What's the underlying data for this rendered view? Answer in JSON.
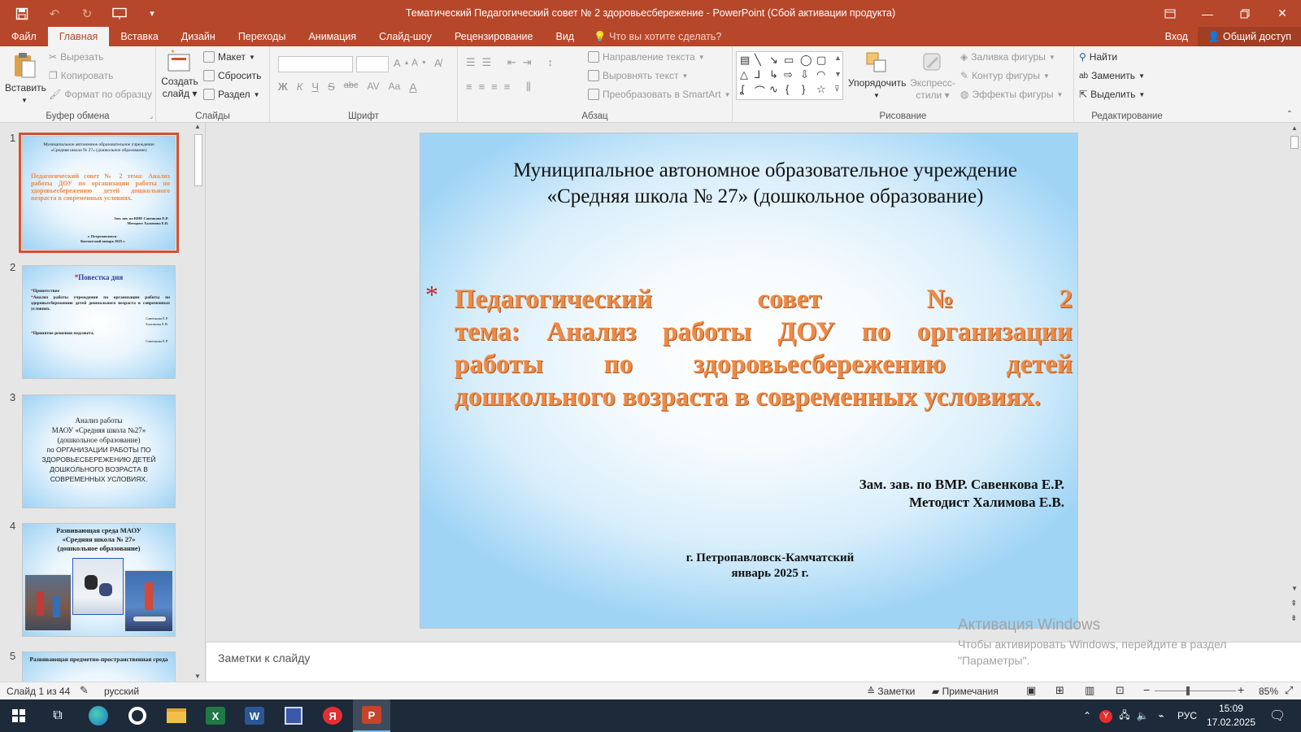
{
  "window": {
    "title": "Тематический Педагогический совет № 2 здоровьесбережение  -  PowerPoint (Сбой активации продукта)",
    "qat_icons": [
      "save-icon",
      "undo-icon",
      "redo-icon",
      "start-slideshow-icon",
      "customize-qat-icon"
    ]
  },
  "tabs": [
    "Файл",
    "Главная",
    "Вставка",
    "Дизайн",
    "Переходы",
    "Анимация",
    "Слайд-шоу",
    "Рецензирование",
    "Вид"
  ],
  "active_tab": "Главная",
  "tell_me": "Что вы хотите сделать?",
  "signin": "Вход",
  "share": "Общий доступ",
  "ribbon": {
    "clipboard": {
      "paste": "Вставить",
      "cut": "Вырезать",
      "copy": "Копировать",
      "format_painter": "Формат по образцу",
      "label": "Буфер обмена"
    },
    "slides": {
      "new_slide_line1": "Создать",
      "new_slide_line2": "слайд",
      "layout": "Макет",
      "reset": "Сбросить",
      "section": "Раздел",
      "label": "Слайды"
    },
    "font": {
      "label": "Шрифт",
      "bold": "Ж",
      "italic": "К",
      "underline": "Ч",
      "strike": "S",
      "shadow": "abc",
      "spacing": "AV",
      "case": "Aa",
      "color": "A"
    },
    "paragraph": {
      "text_direction": "Направление текста",
      "align_text": "Выровнять текст",
      "smartart": "Преобразовать в SmartArt",
      "label": "Абзац"
    },
    "drawing": {
      "arrange": "Упорядочить",
      "quick_styles_line1": "Экспресс-",
      "quick_styles_line2": "стили",
      "shape_fill": "Заливка фигуры",
      "shape_outline": "Контур фигуры",
      "shape_effects": "Эффекты фигуры",
      "label": "Рисование"
    },
    "editing": {
      "find": "Найти",
      "replace": "Заменить",
      "select": "Выделить",
      "label": "Редактирование"
    }
  },
  "thumbnails": [
    {
      "num": "1",
      "line1": "Муниципальное автономное образовательное учреждение",
      "line2": "«Средняя школа № 27» (дошкольное образование)",
      "title": "Педагогический совет № 2 тема: Анализ работы ДОУ по организации работы по здоровьесбережению детей дошкольного возраста в современных условиях.",
      "authors": "Зам. зав. по ВМР. Савенкова Е.Р. Методист Халимова Е.В.",
      "city": "г. Петропавловск-Камчатский январь 2025 г."
    },
    {
      "num": "2",
      "title": "Повестка дня",
      "item1": "Приветствие",
      "item2": "Анализ работы учреждения по организации работы по здоровьесбережению детей дошкольного возраста в современных условиях.",
      "who1": "Савенкова Е.Р.",
      "who2": "Халимова Е.В.",
      "item3": "Принятие решения педсовета.",
      "who3": "Савенкова Е.Р."
    },
    {
      "num": "3",
      "l1": "Анализ работы",
      "l2": "МАОУ «Средняя школа №27»",
      "l3": "(дошкольное образование)",
      "l4": "по ОРГАНИЗАЦИИ РАБОТЫ ПО ЗДОРОВЬЕСБЕРЕЖЕНИЮ ДЕТЕЙ ДОШКОЛЬНОГО ВОЗРАСТА В СОВРЕМЕННЫХ УСЛОВИЯХ."
    },
    {
      "num": "4",
      "l1": "Развивающая среда МАОУ",
      "l2": "«Средняя школа № 27»",
      "l3": "(дошкольное образование)"
    },
    {
      "num": "5",
      "l1": "Развивающая предметно-пространственная среда"
    }
  ],
  "slide": {
    "org_line1": "Муниципальное автономное образовательное учреждение",
    "org_line2": "«Средняя школа № 27» (дошкольное образование)",
    "bullet": "*",
    "title_l1": [
      "Педагогический",
      "совет",
      "№",
      "2"
    ],
    "title_l2": [
      "тема:",
      "Анализ",
      "работы",
      "ДОУ",
      "по",
      "организации"
    ],
    "title_l3": [
      "работы",
      "по",
      "здоровьесбережению",
      "детей"
    ],
    "title_l4": "дошкольного возраста в современных условиях.",
    "author1": "Зам. зав. по ВМР. Савенкова Е.Р.",
    "author2": "Методист Халимова Е.В.",
    "city": "г. Петропавловск-Камчатский",
    "date": "январь 2025 г."
  },
  "notes_placeholder": "Заметки к слайду",
  "activation": {
    "title": "Активация Windows",
    "line1": "Чтобы активировать Windows, перейдите в раздел",
    "line2": "\"Параметры\"."
  },
  "status": {
    "slide_info": "Слайд 1 из 44",
    "language": "русский",
    "notes": "Заметки",
    "comments": "Примечания",
    "zoom": "85%"
  },
  "taskbar": {
    "lang": "РУС",
    "time": "15:09",
    "date": "17.02.2025",
    "excel": "X",
    "word": "W",
    "yandex": "Я",
    "ppt": "P"
  },
  "colors": {
    "accent": "#b7472a",
    "title_orange": "#ee8a46",
    "bullet_red": "#c0282a"
  }
}
